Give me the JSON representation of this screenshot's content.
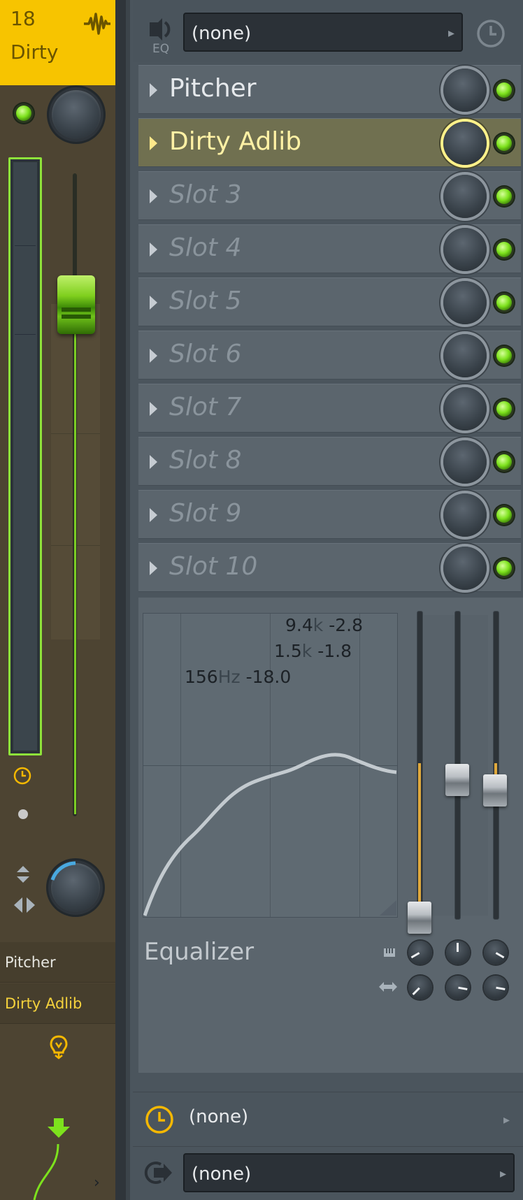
{
  "channel": {
    "number": "18",
    "name": "Dirty",
    "accent_color": "#f7c400",
    "led_color": "#7de21d",
    "slot_labels": [
      "Pitcher",
      "Dirty Adlib"
    ]
  },
  "eq_route": {
    "label": "EQ",
    "value": "(none)"
  },
  "slots": [
    {
      "name": "Pitcher",
      "state": "loaded"
    },
    {
      "name": "Dirty Adlib",
      "state": "selected"
    },
    {
      "name": "Slot 3",
      "state": "empty"
    },
    {
      "name": "Slot 4",
      "state": "empty"
    },
    {
      "name": "Slot 5",
      "state": "empty"
    },
    {
      "name": "Slot 6",
      "state": "empty"
    },
    {
      "name": "Slot 7",
      "state": "empty"
    },
    {
      "name": "Slot 8",
      "state": "empty"
    },
    {
      "name": "Slot 9",
      "state": "empty"
    },
    {
      "name": "Slot 10",
      "state": "empty"
    }
  ],
  "equalizer": {
    "title": "Equalizer",
    "bands": [
      {
        "freq": "9.4",
        "unit": "k",
        "gain": "-2.8"
      },
      {
        "freq": "1.5",
        "unit": "k",
        "gain": "-1.8"
      },
      {
        "freq": "156",
        "unit": "Hz",
        "gain": "-18.0"
      }
    ],
    "band_color": "#e0a93c"
  },
  "send": {
    "value": "(none)"
  },
  "output": {
    "value": "(none)"
  }
}
